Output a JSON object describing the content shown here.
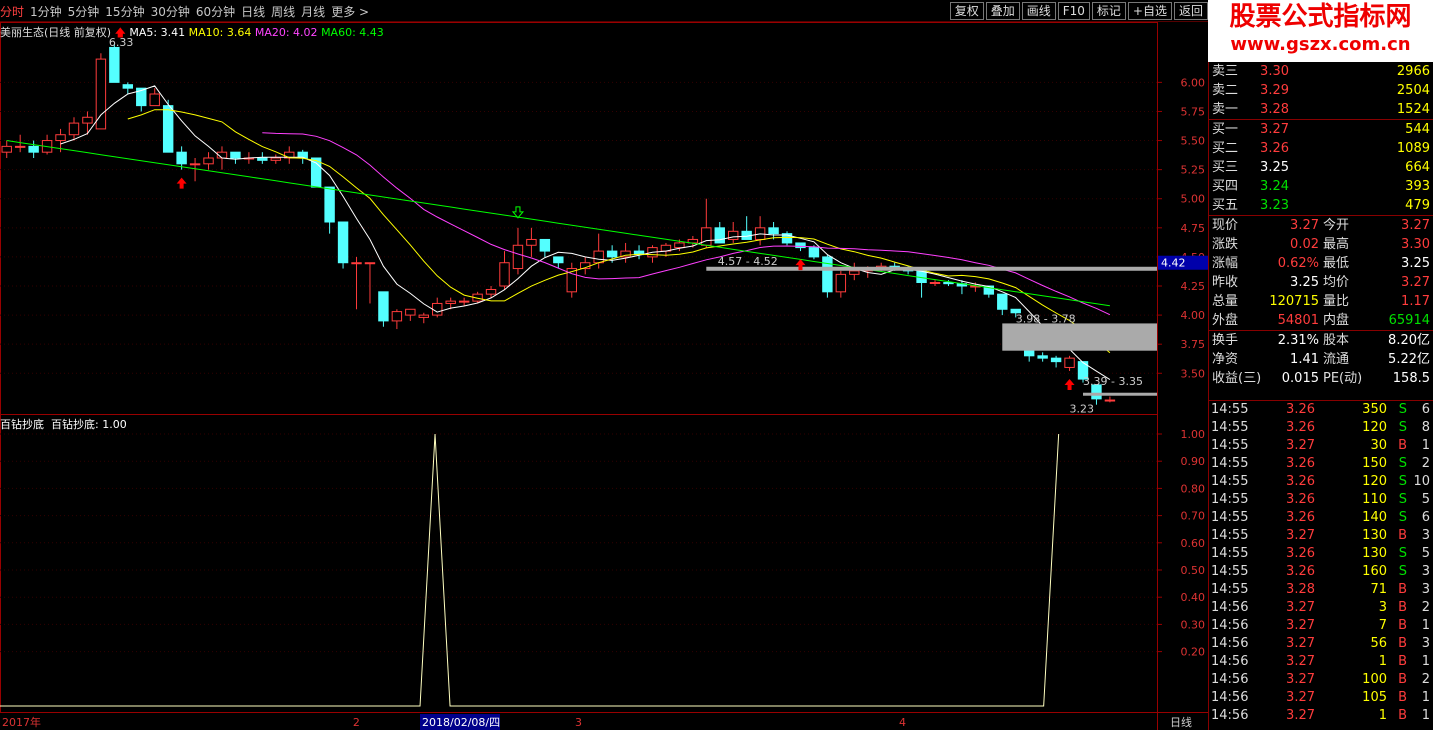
{
  "toolbar": {
    "periods": [
      "分时",
      "1分钟",
      "5分钟",
      "15分钟",
      "30分钟",
      "60分钟",
      "日线",
      "周线",
      "月线",
      "更多 >"
    ],
    "active_index": 0,
    "buttons": [
      "复权",
      "叠加",
      "画线",
      "F10",
      "标记",
      "+自选",
      "返回"
    ]
  },
  "stock": {
    "title": "美丽生态(日线 前复权)"
  },
  "ma": {
    "ma5_label": "MA5: 3.41",
    "ma10_label": "MA10: 3.64",
    "ma20_label": "MA20: 4.02",
    "ma60_label": "MA60: 4.43",
    "ma5_color": "#ffffff",
    "ma10_color": "#ffff00",
    "ma20_color": "#ff40ff",
    "ma60_color": "#00ff00"
  },
  "indicator": {
    "name": "百钻抄底",
    "label": "百钻抄底: 1.00",
    "color": "#ffffc0"
  },
  "price_axis": {
    "ticks": [
      "6.00",
      "5.75",
      "5.50",
      "5.25",
      "5.00",
      "4.75",
      "4.50",
      "4.25",
      "4.00",
      "3.75",
      "3.50"
    ],
    "current": "4.42"
  },
  "indicator_axis": {
    "ticks": [
      "1.00",
      "0.90",
      "0.80",
      "0.70",
      "0.60",
      "0.50",
      "0.40",
      "0.30",
      "0.20"
    ]
  },
  "date_axis": {
    "year": "2017年",
    "months": [
      "2",
      "3",
      "4"
    ],
    "cursor_date": "2018/02/08/四",
    "period": "日线"
  },
  "annotations": {
    "high": "6.33",
    "low": "3.23",
    "zone1": "4.57 - 4.52",
    "zone2": "3.98 - 3.78",
    "zone3": "3.39 - 3.35"
  },
  "chart_data": {
    "type": "candlestick",
    "indicator_spikes_at": [
      0.376,
      0.915
    ],
    "candles": [
      [
        5.4,
        5.5,
        5.35,
        5.45
      ],
      [
        5.45,
        5.55,
        5.4,
        5.45
      ],
      [
        5.45,
        5.5,
        5.35,
        5.4
      ],
      [
        5.4,
        5.55,
        5.38,
        5.5
      ],
      [
        5.5,
        5.6,
        5.4,
        5.55
      ],
      [
        5.55,
        5.7,
        5.5,
        5.65
      ],
      [
        5.65,
        5.75,
        5.55,
        5.7
      ],
      [
        5.6,
        6.25,
        5.6,
        6.2
      ],
      [
        6.3,
        6.33,
        6.0,
        6.0
      ],
      [
        5.98,
        6.0,
        5.9,
        5.95
      ],
      [
        5.95,
        5.95,
        5.75,
        5.8
      ],
      [
        5.8,
        5.95,
        5.8,
        5.9
      ],
      [
        5.8,
        5.85,
        5.4,
        5.4
      ],
      [
        5.4,
        5.45,
        5.25,
        5.3
      ],
      [
        5.3,
        5.35,
        5.15,
        5.3
      ],
      [
        5.3,
        5.4,
        5.25,
        5.35
      ],
      [
        5.35,
        5.45,
        5.25,
        5.4
      ],
      [
        5.4,
        5.4,
        5.3,
        5.35
      ],
      [
        5.35,
        5.4,
        5.3,
        5.35
      ],
      [
        5.35,
        5.4,
        5.3,
        5.33
      ],
      [
        5.33,
        5.38,
        5.3,
        5.35
      ],
      [
        5.35,
        5.45,
        5.3,
        5.4
      ],
      [
        5.4,
        5.42,
        5.3,
        5.35
      ],
      [
        5.35,
        5.35,
        5.1,
        5.1
      ],
      [
        5.1,
        5.1,
        4.7,
        4.8
      ],
      [
        4.8,
        4.8,
        4.4,
        4.45
      ],
      [
        4.45,
        4.5,
        4.05,
        4.45
      ],
      [
        4.45,
        4.45,
        4.1,
        4.45
      ],
      [
        4.2,
        4.2,
        3.9,
        3.95
      ],
      [
        3.95,
        4.05,
        3.88,
        4.03
      ],
      [
        4.0,
        4.05,
        3.95,
        4.05
      ],
      [
        3.98,
        4.02,
        3.93,
        4.0
      ],
      [
        4.0,
        4.15,
        3.98,
        4.1
      ],
      [
        4.1,
        4.15,
        4.05,
        4.12
      ],
      [
        4.12,
        4.15,
        4.08,
        4.12
      ],
      [
        4.12,
        4.2,
        4.1,
        4.18
      ],
      [
        4.18,
        4.25,
        4.15,
        4.22
      ],
      [
        4.25,
        4.55,
        4.22,
        4.45
      ],
      [
        4.4,
        4.75,
        4.35,
        4.6
      ],
      [
        4.6,
        4.75,
        4.5,
        4.65
      ],
      [
        4.65,
        4.65,
        4.5,
        4.55
      ],
      [
        4.5,
        4.5,
        4.4,
        4.45
      ],
      [
        4.2,
        4.45,
        4.15,
        4.4
      ],
      [
        4.4,
        4.5,
        4.35,
        4.45
      ],
      [
        4.45,
        4.7,
        4.4,
        4.55
      ],
      [
        4.55,
        4.6,
        4.45,
        4.5
      ],
      [
        4.5,
        4.62,
        4.45,
        4.55
      ],
      [
        4.55,
        4.6,
        4.48,
        4.52
      ],
      [
        4.5,
        4.6,
        4.45,
        4.58
      ],
      [
        4.55,
        4.62,
        4.5,
        4.6
      ],
      [
        4.58,
        4.65,
        4.55,
        4.62
      ],
      [
        4.62,
        4.68,
        4.58,
        4.65
      ],
      [
        4.6,
        5.0,
        4.58,
        4.75
      ],
      [
        4.75,
        4.8,
        4.65,
        4.62
      ],
      [
        4.65,
        4.8,
        4.62,
        4.72
      ],
      [
        4.72,
        4.85,
        4.65,
        4.65
      ],
      [
        4.65,
        4.85,
        4.6,
        4.75
      ],
      [
        4.75,
        4.8,
        4.65,
        4.7
      ],
      [
        4.7,
        4.72,
        4.6,
        4.62
      ],
      [
        4.62,
        4.62,
        4.55,
        4.58
      ],
      [
        4.58,
        4.6,
        4.48,
        4.5
      ],
      [
        4.5,
        4.52,
        4.15,
        4.2
      ],
      [
        4.2,
        4.38,
        4.15,
        4.35
      ],
      [
        4.35,
        4.45,
        4.3,
        4.38
      ],
      [
        4.38,
        4.42,
        4.32,
        4.4
      ],
      [
        4.4,
        4.45,
        4.38,
        4.42
      ],
      [
        4.42,
        4.45,
        4.38,
        4.4
      ],
      [
        4.4,
        4.42,
        4.35,
        4.38
      ],
      [
        4.38,
        4.4,
        4.15,
        4.28
      ],
      [
        4.28,
        4.3,
        4.25,
        4.28
      ],
      [
        4.28,
        4.3,
        4.25,
        4.27
      ],
      [
        4.27,
        4.3,
        4.18,
        4.25
      ],
      [
        4.25,
        4.28,
        4.2,
        4.25
      ],
      [
        4.25,
        4.25,
        4.15,
        4.18
      ],
      [
        4.18,
        4.18,
        4.0,
        4.05
      ],
      [
        4.05,
        4.05,
        3.98,
        4.02
      ],
      [
        3.7,
        3.78,
        3.6,
        3.65
      ],
      [
        3.65,
        3.68,
        3.6,
        3.63
      ],
      [
        3.63,
        3.65,
        3.55,
        3.6
      ],
      [
        3.55,
        3.65,
        3.52,
        3.63
      ],
      [
        3.6,
        3.6,
        3.42,
        3.45
      ],
      [
        3.4,
        3.4,
        3.23,
        3.28
      ],
      [
        3.27,
        3.3,
        3.25,
        3.27
      ]
    ]
  },
  "quote": {
    "asks": [
      {
        "label": "卖三",
        "price": "3.30",
        "vol": "2966"
      },
      {
        "label": "卖二",
        "price": "3.29",
        "vol": "2504"
      },
      {
        "label": "卖一",
        "price": "3.28",
        "vol": "1524"
      }
    ],
    "bids": [
      {
        "label": "买一",
        "price": "3.27",
        "vol": "544"
      },
      {
        "label": "买二",
        "price": "3.26",
        "vol": "1089"
      },
      {
        "label": "买三",
        "price": "3.25",
        "vol": "664"
      },
      {
        "label": "买四",
        "price": "3.24",
        "vol": "393"
      },
      {
        "label": "买五",
        "price": "3.23",
        "vol": "479"
      }
    ],
    "stats": [
      {
        "l1": "现价",
        "v1": "3.27",
        "l2": "今开",
        "v2": "3.27"
      },
      {
        "l1": "涨跌",
        "v1": "0.02",
        "l2": "最高",
        "v2": "3.30"
      },
      {
        "l1": "涨幅",
        "v1": "0.62%",
        "l2": "最低",
        "v2": "3.25"
      },
      {
        "l1": "昨收",
        "v1": "3.25",
        "l2": "均价",
        "v2": "3.27"
      },
      {
        "l1": "总量",
        "v1": "120715",
        "l2": "量比",
        "v2": "1.17"
      },
      {
        "l1": "外盘",
        "v1": "54801",
        "l2": "内盘",
        "v2": "65914"
      }
    ],
    "fund": [
      {
        "l1": "换手",
        "v1": "2.31%",
        "l2": "股本",
        "v2": "8.20亿"
      },
      {
        "l1": "净资",
        "v1": "1.41",
        "l2": "流通",
        "v2": "5.22亿"
      },
      {
        "l1": "收益(三)",
        "v1": "0.015",
        "l2": "PE(动)",
        "v2": "158.5"
      }
    ]
  },
  "ticks": [
    {
      "t": "14:55",
      "p": "3.26",
      "v": "350",
      "d": "S",
      "n": "6"
    },
    {
      "t": "14:55",
      "p": "3.26",
      "v": "120",
      "d": "S",
      "n": "8"
    },
    {
      "t": "14:55",
      "p": "3.27",
      "v": "30",
      "d": "B",
      "n": "1"
    },
    {
      "t": "14:55",
      "p": "3.26",
      "v": "150",
      "d": "S",
      "n": "2"
    },
    {
      "t": "14:55",
      "p": "3.26",
      "v": "120",
      "d": "S",
      "n": "10"
    },
    {
      "t": "14:55",
      "p": "3.26",
      "v": "110",
      "d": "S",
      "n": "5"
    },
    {
      "t": "14:55",
      "p": "3.26",
      "v": "140",
      "d": "S",
      "n": "6"
    },
    {
      "t": "14:55",
      "p": "3.27",
      "v": "130",
      "d": "B",
      "n": "3"
    },
    {
      "t": "14:55",
      "p": "3.26",
      "v": "130",
      "d": "S",
      "n": "5"
    },
    {
      "t": "14:55",
      "p": "3.26",
      "v": "160",
      "d": "S",
      "n": "3"
    },
    {
      "t": "14:55",
      "p": "3.28",
      "v": "71",
      "d": "B",
      "n": "3"
    },
    {
      "t": "14:56",
      "p": "3.27",
      "v": "3",
      "d": "B",
      "n": "2"
    },
    {
      "t": "14:56",
      "p": "3.27",
      "v": "7",
      "d": "B",
      "n": "1"
    },
    {
      "t": "14:56",
      "p": "3.27",
      "v": "56",
      "d": "B",
      "n": "3"
    },
    {
      "t": "14:56",
      "p": "3.27",
      "v": "1",
      "d": "B",
      "n": "1"
    },
    {
      "t": "14:56",
      "p": "3.27",
      "v": "100",
      "d": "B",
      "n": "2"
    },
    {
      "t": "14:56",
      "p": "3.27",
      "v": "105",
      "d": "B",
      "n": "1"
    },
    {
      "t": "14:56",
      "p": "3.27",
      "v": "1",
      "d": "B",
      "n": "1"
    }
  ],
  "logo": {
    "line1": "股票公式指标网",
    "line2": "www.gszx.com.cn"
  }
}
